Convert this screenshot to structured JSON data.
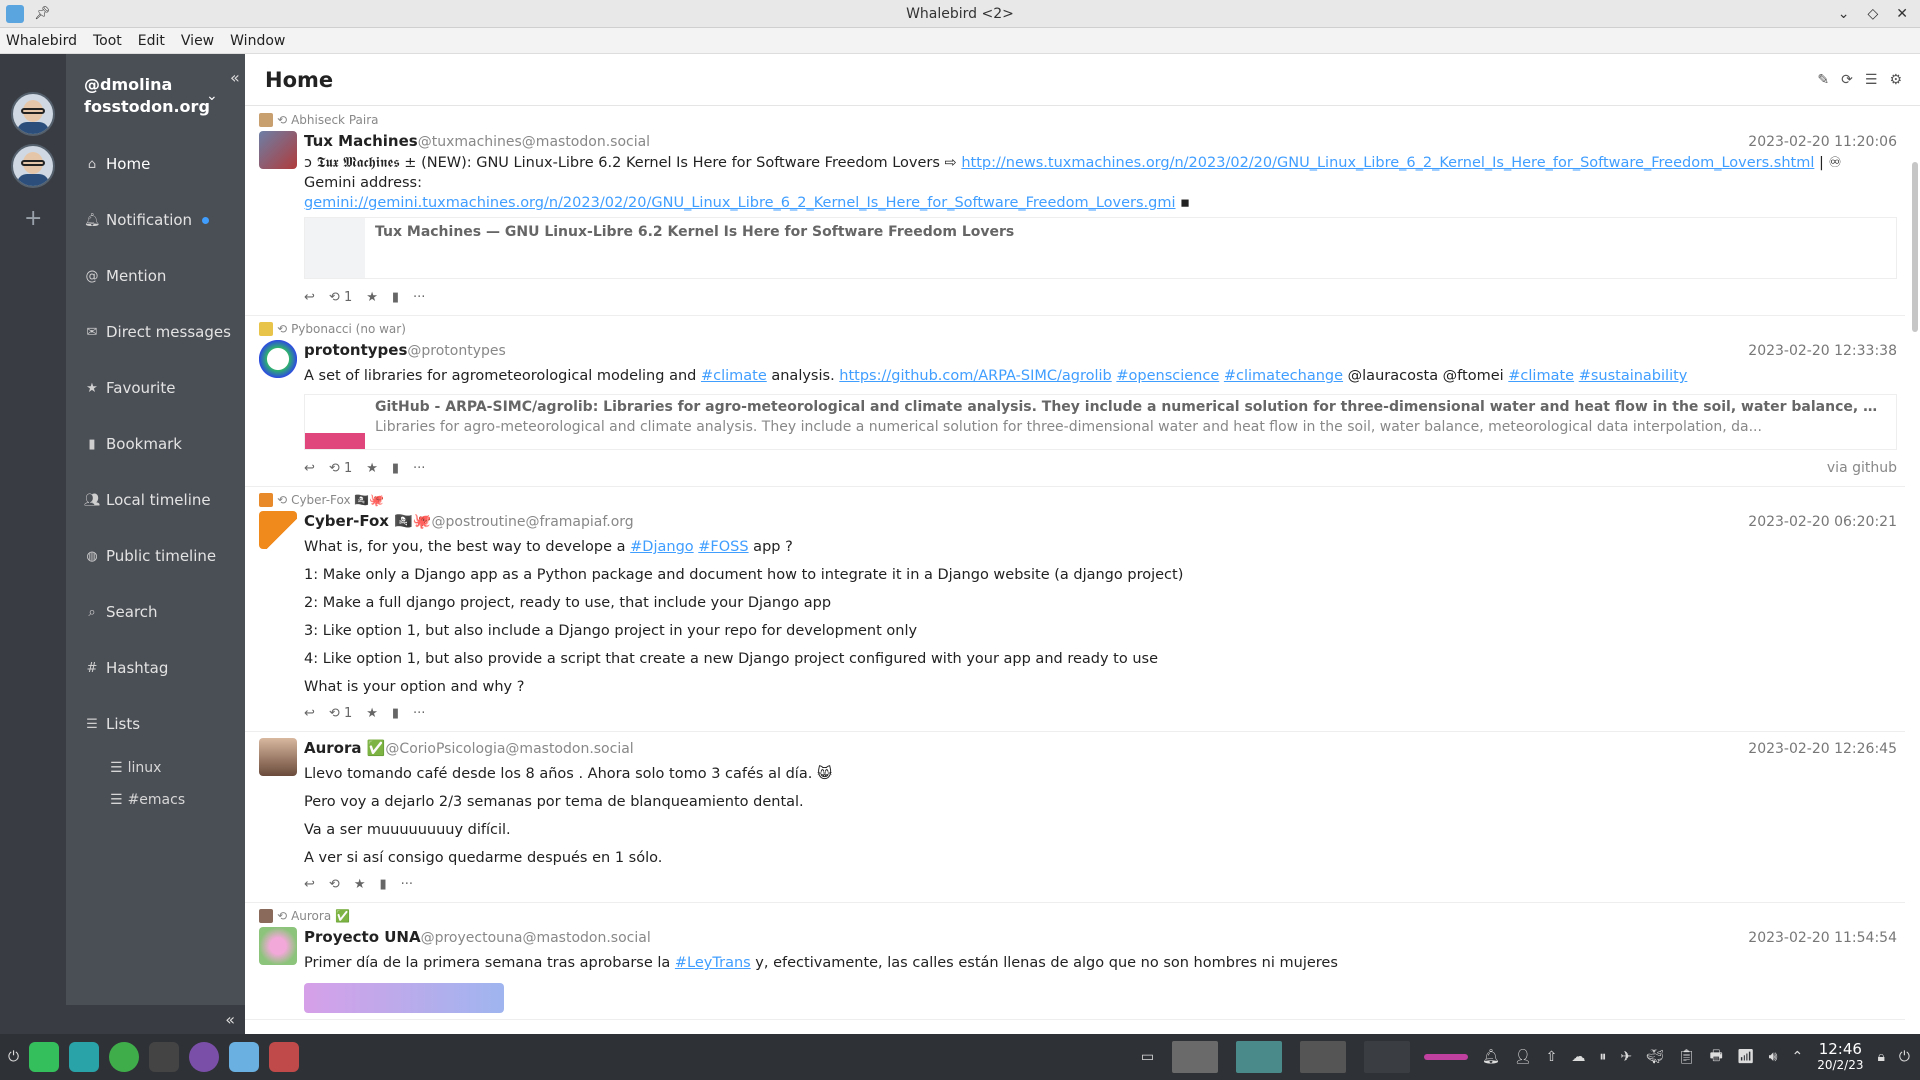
{
  "window": {
    "title": "Whalebird <2>"
  },
  "menu": [
    "Whalebird",
    "Toot",
    "Edit",
    "View",
    "Window"
  ],
  "account": {
    "username": "@dmolina",
    "domain": "fosstodon.org"
  },
  "nav": [
    {
      "label": "Home",
      "icon": "home-icon",
      "glyph": "⌂",
      "active": true
    },
    {
      "label": "Notification",
      "icon": "bell-icon",
      "glyph": "🔔︎"
    },
    {
      "label": "Mention",
      "icon": "at-icon",
      "glyph": "@"
    },
    {
      "label": "Direct messages",
      "icon": "envelope-icon",
      "glyph": "✉"
    },
    {
      "label": "Favourite",
      "icon": "star-icon",
      "glyph": "★"
    },
    {
      "label": "Bookmark",
      "icon": "bookmark-icon",
      "glyph": "▮"
    },
    {
      "label": "Local timeline",
      "icon": "users-icon",
      "glyph": "👥︎"
    },
    {
      "label": "Public timeline",
      "icon": "globe-icon",
      "glyph": "◍"
    },
    {
      "label": "Search",
      "icon": "search-icon",
      "glyph": "⌕"
    },
    {
      "label": "Hashtag",
      "icon": "hash-icon",
      "glyph": "#"
    },
    {
      "label": "Lists",
      "icon": "list-icon",
      "glyph": "☰"
    }
  ],
  "lists": [
    "linux",
    "#emacs"
  ],
  "page": {
    "title": "Home"
  },
  "statuses": [
    {
      "reblogged_by": "Abhiseck Paira",
      "display_name": "Tux Machines",
      "acct": "@tuxmachines@mastodon.social",
      "time": "2023-02-20 11:20:06",
      "text_1": "ↄ 𝕿𝖚𝖝 𝕸𝖆𝖈𝖍𝖎𝖓𝖊𝖘 ± (NEW): GNU Linux-Libre 6.2 Kernel Is Here for Software Freedom Lovers ⇨ ",
      "link_1": "http://news.tuxmachines.org/n/2023/02/20/GNU_Linux_Libre_6_2_Kernel_Is_Here_for_Software_Freedom_Lovers.shtml",
      "text_2": " | ♾ Gemini address:",
      "link_2": "gemini://gemini.tuxmachines.org/n/2023/02/20/GNU_Linux_Libre_6_2_Kernel_Is_Here_for_Software_Freedom_Lovers.gmi",
      "card_title": "Tux Machines — GNU Linux-Libre 6.2 Kernel Is Here for Software Freedom Lovers",
      "reblogs": "1"
    },
    {
      "reblogged_by": "Pybonacci (no war)",
      "display_name": "protontypes",
      "acct": "@protontypes",
      "time": "2023-02-20 12:33:38",
      "text_a": "A set of libraries for agrometeorological modeling and ",
      "tag_a": "#climate",
      "text_b": " analysis. ",
      "link": "https://github.com/ARPA-SIMC/agrolib",
      "tag_b": "#openscience",
      "tag_c": "#climatechange",
      "text_c": " @lauracosta @ftomei ",
      "tag_d": "#climate",
      "tag_e": "#sustainability",
      "card_title": "GitHub - ARPA-SIMC/agrolib: Libraries for agro-meteorological and climate analysis. They include a numerical solution for three-dimensional water and heat flow in the soil, water balance, meteorological data interpolation, daily we...",
      "card_desc": "Libraries for agro-meteorological and climate analysis. They include a numerical solution for three-dimensional water and heat flow in the soil, water balance, meteorological data interpolation, da...",
      "reblogs": "1",
      "via": "via github"
    },
    {
      "reblogged_by": "Cyber-Fox 🏴‍☠️🐙",
      "display_name": "Cyber-Fox 🏴‍☠️🐙",
      "acct": "@postroutine@framapiaf.org",
      "time": "2023-02-20 06:20:21",
      "line_1a": "What is, for you, the best way to develope a ",
      "tag_1": "#Django",
      "tag_2": "#FOSS",
      "line_1b": " app ?",
      "line_2": "1: Make only a Django app as a Python package and document how to integrate it in a Django website (a django project)",
      "line_3": "2: Make a full django project, ready to use, that include your Django app",
      "line_4": "3: Like option 1, but also include a Django project in your repo for development only",
      "line_5": "4: Like option 1, but also provide a script that create a new Django project configured with your app and ready to use",
      "line_6": "What is your option and why ?",
      "reblogs": "1"
    },
    {
      "display_name": "Aurora ✅",
      "acct": "@CorioPsicologia@mastodon.social",
      "time": "2023-02-20 12:26:45",
      "line_1": "Llevo tomando café desde los 8 años . Ahora solo tomo 3 cafés al día. 😸",
      "line_2": "Pero voy a dejarlo 2/3 semanas por tema de blanqueamiento dental.",
      "line_3": "Va a ser muuuuuuuuy difícil.",
      "line_4": "A ver si así consigo quedarme después en 1 sólo."
    },
    {
      "reblogged_by": "Aurora ✅",
      "display_name": "Proyecto UNA",
      "acct": "@proyectouna@mastodon.social",
      "time": "2023-02-20 11:54:54",
      "text_a": "Primer día de la primera semana tras aprobarse la ",
      "tag": "#LeyTrans",
      "text_b": " y, efectivamente, las calles están llenas de algo que no son hombres ni mujeres"
    }
  ],
  "taskbar": {
    "time": "12:46",
    "date": "20/2/23"
  }
}
